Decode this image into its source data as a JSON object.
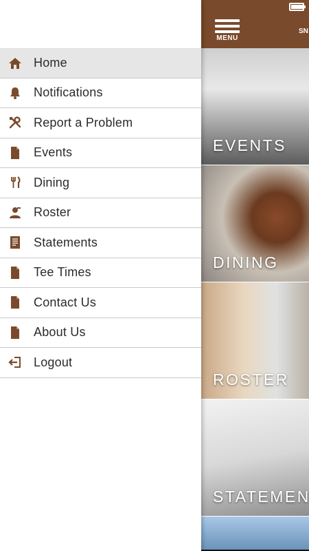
{
  "menu": {
    "items": [
      {
        "label": "Home",
        "icon": "home-icon",
        "active": true
      },
      {
        "label": "Notifications",
        "icon": "bell-icon",
        "active": false
      },
      {
        "label": "Report a Problem",
        "icon": "tools-icon",
        "active": false
      },
      {
        "label": "Events",
        "icon": "document-icon",
        "active": false
      },
      {
        "label": "Dining",
        "icon": "fork-knife-icon",
        "active": false
      },
      {
        "label": "Roster",
        "icon": "person-icon",
        "active": false
      },
      {
        "label": "Statements",
        "icon": "statement-icon",
        "active": false
      },
      {
        "label": "Tee Times",
        "icon": "document-icon",
        "active": false
      },
      {
        "label": "Contact Us",
        "icon": "document-icon",
        "active": false
      },
      {
        "label": "About Us",
        "icon": "document-icon",
        "active": false
      },
      {
        "label": "Logout",
        "icon": "logout-icon",
        "active": false
      }
    ]
  },
  "header": {
    "menu_label": "MENU",
    "right_label": "SN"
  },
  "status": {
    "battery_level": 1.0
  },
  "tiles": [
    {
      "label": "EVENTS"
    },
    {
      "label": "DINING"
    },
    {
      "label": "ROSTER"
    },
    {
      "label": "STATEMEN"
    }
  ],
  "colors": {
    "accent": "#7a4a2c",
    "icon": "#7a4a2c",
    "active_bg": "#e6e6e6",
    "divider": "#c9c9c9"
  }
}
